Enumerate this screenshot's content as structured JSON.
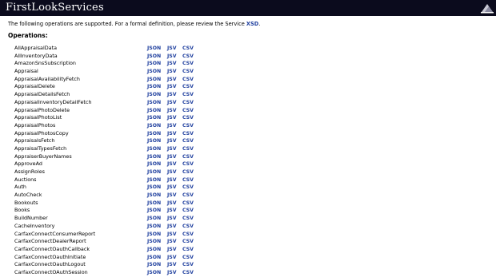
{
  "header": {
    "title": "FirstLookServices"
  },
  "intro": {
    "text_before": "The following operations are supported. For a formal definition, please review the Service",
    "xsd_link": "XSD",
    "text_after": "."
  },
  "operations_heading": "Operations:",
  "formats": [
    "JSON",
    "JSV",
    "CSV"
  ],
  "operations": [
    "AllAppraisalData",
    "AllInventoryData",
    "AmazonSnsSubscription",
    "Appraisal",
    "AppraisalAvailabilityFetch",
    "AppraisalDelete",
    "AppraisalDetailsFetch",
    "AppraisalInventoryDetailFetch",
    "AppraisalPhotoDelete",
    "AppraisalPhotoList",
    "AppraisalPhotos",
    "AppraisalPhotosCopy",
    "AppraisalsFetch",
    "AppraisalTypesFetch",
    "AppraiserBuyerNames",
    "ApproveAd",
    "AssignRoles",
    "Auctions",
    "Auth",
    "AutoCheck",
    "Bookouts",
    "Books",
    "BuildNumber",
    "CacheInventory",
    "CarfaxConnectConsumerReport",
    "CarfaxConnectDealerReport",
    "CarfaxConnectOauthCallback",
    "CarfaxConnectOauthInitiate",
    "CarfaxConnectOauthLogout",
    "CarfaxConnectOAuthSession"
  ],
  "colors": {
    "header_bg": "#0b0b1d",
    "link": "#1f3f9e"
  }
}
